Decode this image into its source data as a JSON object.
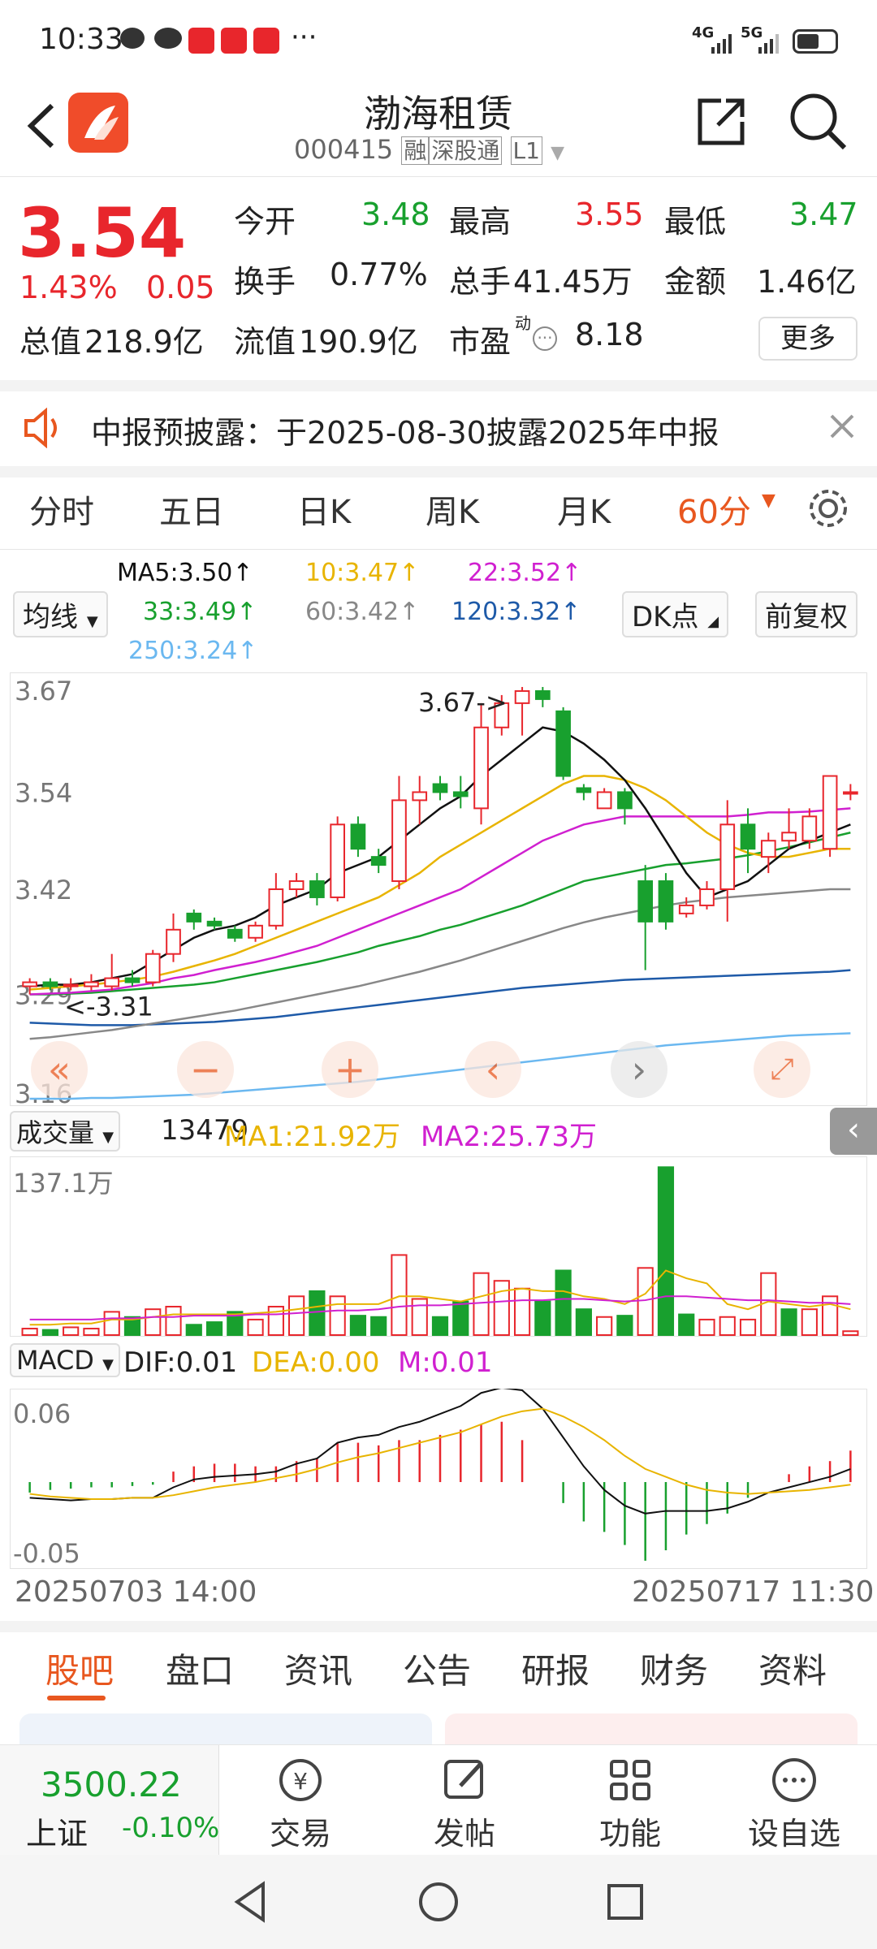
{
  "status_bar": {
    "time": "10:33",
    "icons_left": [
      "message-icon",
      "wechat-icon",
      "app-badge-icon",
      "app-badge-icon",
      "app-badge-icon"
    ],
    "more": "···",
    "network1": "4G",
    "network2": "5G"
  },
  "header": {
    "title": "渤海租赁",
    "code": "000415",
    "tag1": "融",
    "tag2": "深股通",
    "tag3": "L1"
  },
  "quote": {
    "price": "3.54",
    "change_pct": "1.43%",
    "change": "0.05",
    "open_label": "今开",
    "open": "3.48",
    "high_label": "最高",
    "high": "3.55",
    "low_label": "最低",
    "low": "3.47",
    "turnover_label": "换手",
    "turnover": "0.77%",
    "volume_label": "总手",
    "volume": "41.45万",
    "amount_label": "金额",
    "amount": "1.46亿",
    "mcap_label": "总值",
    "mcap": "218.9亿",
    "float_label": "流值",
    "float": "190.9亿",
    "pe_label": "市盈",
    "pe_sup": "动",
    "pe": "8.18",
    "more_button": "更多"
  },
  "notice": {
    "text": "中报预披露：于2025-08-30披露2025年中报"
  },
  "period_tabs": [
    "分时",
    "五日",
    "日K",
    "周K",
    "月K",
    "60分"
  ],
  "chart_header": {
    "ma_button": "均线",
    "ma5": "MA5:3.50↑",
    "ma10": "10:3.47↑",
    "ma22": "22:3.52↑",
    "ma33": "33:3.49↑",
    "ma60": "60:3.42↑",
    "ma120": "120:3.32↑",
    "ma250": "250:3.24↑",
    "dk_button": "DK点",
    "adjust_button": "前复权"
  },
  "colors": {
    "up": "#e8262c",
    "down": "#18a02e",
    "accent": "#e8571f",
    "ma5": "#111111",
    "ma10": "#e8b400",
    "ma22": "#d020d0",
    "ma33": "#18a02e",
    "ma60": "#888888",
    "ma120": "#1e5aa8",
    "ma250": "#6bb8f0"
  },
  "chart_data": [
    {
      "type": "candlestick",
      "ylim": [
        3.16,
        3.68
      ],
      "y_ticks": [
        "3.67",
        "3.54",
        "3.42",
        "3.29",
        "3.16"
      ],
      "high_annotation": "3.67->",
      "low_annotation": "<-3.31",
      "candles": [
        {
          "o": 3.3,
          "c": 3.305,
          "h": 3.31,
          "l": 3.29
        },
        {
          "o": 3.305,
          "c": 3.3,
          "h": 3.31,
          "l": 3.295
        },
        {
          "o": 3.3,
          "c": 3.302,
          "h": 3.31,
          "l": 3.295
        },
        {
          "o": 3.3,
          "c": 3.305,
          "h": 3.315,
          "l": 3.295
        },
        {
          "o": 3.3,
          "c": 3.31,
          "h": 3.34,
          "l": 3.295
        },
        {
          "o": 3.31,
          "c": 3.305,
          "h": 3.32,
          "l": 3.3
        },
        {
          "o": 3.305,
          "c": 3.34,
          "h": 3.345,
          "l": 3.3
        },
        {
          "o": 3.34,
          "c": 3.37,
          "h": 3.39,
          "l": 3.33
        },
        {
          "o": 3.39,
          "c": 3.38,
          "h": 3.395,
          "l": 3.37
        },
        {
          "o": 3.38,
          "c": 3.375,
          "h": 3.385,
          "l": 3.37
        },
        {
          "o": 3.37,
          "c": 3.36,
          "h": 3.375,
          "l": 3.355
        },
        {
          "o": 3.36,
          "c": 3.375,
          "h": 3.38,
          "l": 3.355
        },
        {
          "o": 3.375,
          "c": 3.42,
          "h": 3.44,
          "l": 3.37
        },
        {
          "o": 3.42,
          "c": 3.43,
          "h": 3.44,
          "l": 3.41
        },
        {
          "o": 3.43,
          "c": 3.41,
          "h": 3.44,
          "l": 3.4
        },
        {
          "o": 3.41,
          "c": 3.5,
          "h": 3.51,
          "l": 3.405
        },
        {
          "o": 3.5,
          "c": 3.47,
          "h": 3.51,
          "l": 3.46
        },
        {
          "o": 3.46,
          "c": 3.45,
          "h": 3.47,
          "l": 3.44
        },
        {
          "o": 3.43,
          "c": 3.53,
          "h": 3.56,
          "l": 3.42
        },
        {
          "o": 3.53,
          "c": 3.54,
          "h": 3.56,
          "l": 3.5
        },
        {
          "o": 3.55,
          "c": 3.54,
          "h": 3.56,
          "l": 3.53
        },
        {
          "o": 3.54,
          "c": 3.535,
          "h": 3.56,
          "l": 3.52
        },
        {
          "o": 3.52,
          "c": 3.62,
          "h": 3.65,
          "l": 3.5
        },
        {
          "o": 3.62,
          "c": 3.65,
          "h": 3.66,
          "l": 3.61
        },
        {
          "o": 3.65,
          "c": 3.665,
          "h": 3.67,
          "l": 3.61
        },
        {
          "o": 3.665,
          "c": 3.655,
          "h": 3.67,
          "l": 3.645
        },
        {
          "o": 3.64,
          "c": 3.56,
          "h": 3.645,
          "l": 3.555
        },
        {
          "o": 3.545,
          "c": 3.54,
          "h": 3.55,
          "l": 3.53
        },
        {
          "o": 3.52,
          "c": 3.54,
          "h": 3.545,
          "l": 3.52
        },
        {
          "o": 3.54,
          "c": 3.52,
          "h": 3.545,
          "l": 3.5
        },
        {
          "o": 3.43,
          "c": 3.38,
          "h": 3.45,
          "l": 3.32
        },
        {
          "o": 3.43,
          "c": 3.38,
          "h": 3.44,
          "l": 3.37
        },
        {
          "o": 3.39,
          "c": 3.4,
          "h": 3.41,
          "l": 3.385
        },
        {
          "o": 3.4,
          "c": 3.42,
          "h": 3.43,
          "l": 3.395
        },
        {
          "o": 3.42,
          "c": 3.5,
          "h": 3.53,
          "l": 3.38
        },
        {
          "o": 3.5,
          "c": 3.47,
          "h": 3.52,
          "l": 3.44
        },
        {
          "o": 3.46,
          "c": 3.48,
          "h": 3.49,
          "l": 3.44
        },
        {
          "o": 3.48,
          "c": 3.49,
          "h": 3.52,
          "l": 3.47
        },
        {
          "o": 3.48,
          "c": 3.51,
          "h": 3.52,
          "l": 3.47
        },
        {
          "o": 3.47,
          "c": 3.56,
          "h": 3.56,
          "l": 3.46
        },
        {
          "o": 3.54,
          "c": 3.54,
          "h": 3.55,
          "l": 3.53
        }
      ],
      "ma": {
        "ma5": [
          3.3,
          3.302,
          3.302,
          3.305,
          3.31,
          3.315,
          3.33,
          3.345,
          3.36,
          3.37,
          3.375,
          3.385,
          3.4,
          3.41,
          3.42,
          3.44,
          3.45,
          3.46,
          3.48,
          3.5,
          3.52,
          3.535,
          3.56,
          3.58,
          3.6,
          3.62,
          3.615,
          3.6,
          3.58,
          3.555,
          3.52,
          3.48,
          3.44,
          3.41,
          3.42,
          3.43,
          3.45,
          3.47,
          3.48,
          3.49,
          3.5
        ],
        "ma10": [
          3.296,
          3.298,
          3.3,
          3.302,
          3.305,
          3.308,
          3.312,
          3.318,
          3.325,
          3.332,
          3.34,
          3.35,
          3.36,
          3.37,
          3.38,
          3.39,
          3.4,
          3.41,
          3.425,
          3.44,
          3.46,
          3.475,
          3.49,
          3.505,
          3.52,
          3.535,
          3.55,
          3.56,
          3.56,
          3.555,
          3.545,
          3.53,
          3.51,
          3.49,
          3.475,
          3.465,
          3.46,
          3.46,
          3.465,
          3.47,
          3.47
        ],
        "ma22": [
          3.29,
          3.291,
          3.292,
          3.294,
          3.296,
          3.3,
          3.304,
          3.31,
          3.314,
          3.32,
          3.325,
          3.33,
          3.336,
          3.343,
          3.35,
          3.36,
          3.37,
          3.38,
          3.39,
          3.4,
          3.41,
          3.42,
          3.435,
          3.45,
          3.465,
          3.48,
          3.49,
          3.5,
          3.505,
          3.51,
          3.51,
          3.51,
          3.51,
          3.51,
          3.51,
          3.512,
          3.515,
          3.515,
          3.516,
          3.518,
          3.52
        ],
        "ma33": [
          3.29,
          3.29,
          3.291,
          3.292,
          3.294,
          3.296,
          3.298,
          3.3,
          3.302,
          3.305,
          3.31,
          3.315,
          3.32,
          3.325,
          3.33,
          3.336,
          3.342,
          3.35,
          3.356,
          3.362,
          3.37,
          3.376,
          3.384,
          3.392,
          3.4,
          3.41,
          3.42,
          3.43,
          3.435,
          3.44,
          3.445,
          3.45,
          3.452,
          3.455,
          3.458,
          3.462,
          3.467,
          3.472,
          3.478,
          3.484,
          3.49
        ],
        "ma60": [
          3.235,
          3.237,
          3.24,
          3.243,
          3.246,
          3.25,
          3.254,
          3.258,
          3.262,
          3.266,
          3.27,
          3.275,
          3.28,
          3.285,
          3.29,
          3.295,
          3.3,
          3.306,
          3.312,
          3.318,
          3.325,
          3.332,
          3.34,
          3.348,
          3.356,
          3.364,
          3.372,
          3.379,
          3.385,
          3.39,
          3.395,
          3.4,
          3.404,
          3.407,
          3.41,
          3.412,
          3.414,
          3.416,
          3.418,
          3.42,
          3.42
        ],
        "ma120": [
          3.255,
          3.254,
          3.253,
          3.252,
          3.252,
          3.252,
          3.253,
          3.254,
          3.255,
          3.256,
          3.258,
          3.26,
          3.262,
          3.265,
          3.268,
          3.271,
          3.274,
          3.277,
          3.28,
          3.283,
          3.286,
          3.289,
          3.292,
          3.295,
          3.298,
          3.3,
          3.302,
          3.304,
          3.306,
          3.308,
          3.309,
          3.31,
          3.311,
          3.312,
          3.313,
          3.314,
          3.315,
          3.316,
          3.317,
          3.318,
          3.32
        ],
        "ma250": [
          3.161,
          3.161,
          3.161,
          3.162,
          3.162,
          3.163,
          3.164,
          3.165,
          3.166,
          3.168,
          3.17,
          3.172,
          3.174,
          3.176,
          3.178,
          3.18,
          3.182,
          3.185,
          3.188,
          3.191,
          3.194,
          3.197,
          3.2,
          3.203,
          3.206,
          3.209,
          3.212,
          3.215,
          3.218,
          3.221,
          3.224,
          3.227,
          3.229,
          3.231,
          3.233,
          3.235,
          3.237,
          3.239,
          3.24,
          3.241,
          3.242
        ]
      }
    },
    {
      "type": "bar",
      "volume_label": "成交量",
      "volume_value": "13479",
      "ma1": "MA1:21.92万",
      "ma2": "MA2:25.73万",
      "top_tick": "137.1万",
      "ylim": [
        0,
        137.1
      ],
      "values": [
        5,
        4,
        6,
        5,
        18,
        14,
        20,
        22,
        8,
        10,
        18,
        12,
        22,
        30,
        34,
        30,
        15,
        14,
        62,
        28,
        14,
        26,
        48,
        42,
        36,
        26,
        50,
        20,
        14,
        15,
        52,
        130,
        16,
        12,
        14,
        12,
        48,
        20,
        20,
        30,
        3
      ],
      "up": [
        true,
        false,
        true,
        true,
        true,
        false,
        true,
        true,
        false,
        false,
        false,
        true,
        true,
        true,
        false,
        true,
        false,
        false,
        true,
        true,
        false,
        false,
        true,
        true,
        true,
        false,
        false,
        false,
        true,
        false,
        true,
        false,
        false,
        true,
        true,
        true,
        true,
        false,
        true,
        true,
        true
      ],
      "ma1_line": [
        8,
        8,
        9,
        9,
        12,
        12,
        14,
        16,
        16,
        16,
        16,
        17,
        18,
        20,
        22,
        24,
        24,
        24,
        30,
        30,
        28,
        26,
        30,
        34,
        36,
        34,
        34,
        30,
        28,
        24,
        32,
        50,
        44,
        40,
        24,
        20,
        26,
        24,
        22,
        24,
        20
      ],
      "ma2_line": [
        12,
        12,
        12,
        12,
        13,
        13,
        14,
        14,
        15,
        15,
        15,
        16,
        16,
        17,
        18,
        19,
        19,
        20,
        22,
        23,
        23,
        24,
        25,
        26,
        27,
        27,
        28,
        28,
        27,
        26,
        27,
        30,
        30,
        29,
        28,
        27,
        27,
        26,
        25,
        25,
        24
      ]
    },
    {
      "type": "macd",
      "button": "MACD",
      "dif": "DIF:0.01",
      "dea": "DEA:0.00",
      "m": "M:0.01",
      "y_ticks": [
        "0.06",
        "-0.05"
      ],
      "ylim": [
        -0.065,
        0.07
      ],
      "dif_line": [
        -0.012,
        -0.013,
        -0.014,
        -0.013,
        -0.013,
        -0.012,
        -0.012,
        -0.004,
        0.002,
        0.004,
        0.005,
        0.006,
        0.008,
        0.014,
        0.018,
        0.03,
        0.034,
        0.036,
        0.042,
        0.046,
        0.052,
        0.058,
        0.068,
        0.072,
        0.07,
        0.056,
        0.034,
        0.012,
        -0.006,
        -0.018,
        -0.024,
        -0.022,
        -0.022,
        -0.022,
        -0.02,
        -0.015,
        -0.008,
        -0.004,
        0.0,
        0.004,
        0.01
      ],
      "dea_line": [
        -0.009,
        -0.011,
        -0.012,
        -0.013,
        -0.013,
        -0.012,
        -0.012,
        -0.01,
        -0.007,
        -0.004,
        -0.002,
        0.0,
        0.003,
        0.006,
        0.01,
        0.015,
        0.019,
        0.022,
        0.026,
        0.03,
        0.034,
        0.038,
        0.044,
        0.05,
        0.054,
        0.056,
        0.05,
        0.042,
        0.032,
        0.02,
        0.01,
        0.004,
        -0.002,
        -0.006,
        -0.008,
        -0.009,
        -0.008,
        -0.007,
        -0.006,
        -0.004,
        -0.002
      ],
      "bars": [
        -0.008,
        -0.006,
        -0.005,
        -0.004,
        -0.004,
        -0.003,
        -0.002,
        0.008,
        0.012,
        0.014,
        0.014,
        0.012,
        0.012,
        0.016,
        0.018,
        0.03,
        0.03,
        0.028,
        0.032,
        0.032,
        0.036,
        0.04,
        0.044,
        0.046,
        0.032,
        0.0,
        -0.016,
        -0.03,
        -0.038,
        -0.048,
        -0.06,
        -0.052,
        -0.04,
        -0.032,
        -0.024,
        -0.012,
        0.0,
        0.006,
        0.012,
        0.016,
        0.024
      ]
    }
  ],
  "chart_footer": {
    "start": "20250703 14:00",
    "end": "20250717 11:30"
  },
  "bottom_tabs": [
    "股吧",
    "盘口",
    "资讯",
    "公告",
    "研报",
    "财务",
    "资料"
  ],
  "index_widget": {
    "value": "3500.22",
    "name": "上证",
    "change": "-0.10%"
  },
  "bottom_nav": [
    {
      "label": "交易",
      "icon": "yuan-exchange-icon"
    },
    {
      "label": "发帖",
      "icon": "edit-post-icon"
    },
    {
      "label": "功能",
      "icon": "apps-grid-icon"
    },
    {
      "label": "设自选",
      "icon": "more-circle-icon"
    }
  ]
}
